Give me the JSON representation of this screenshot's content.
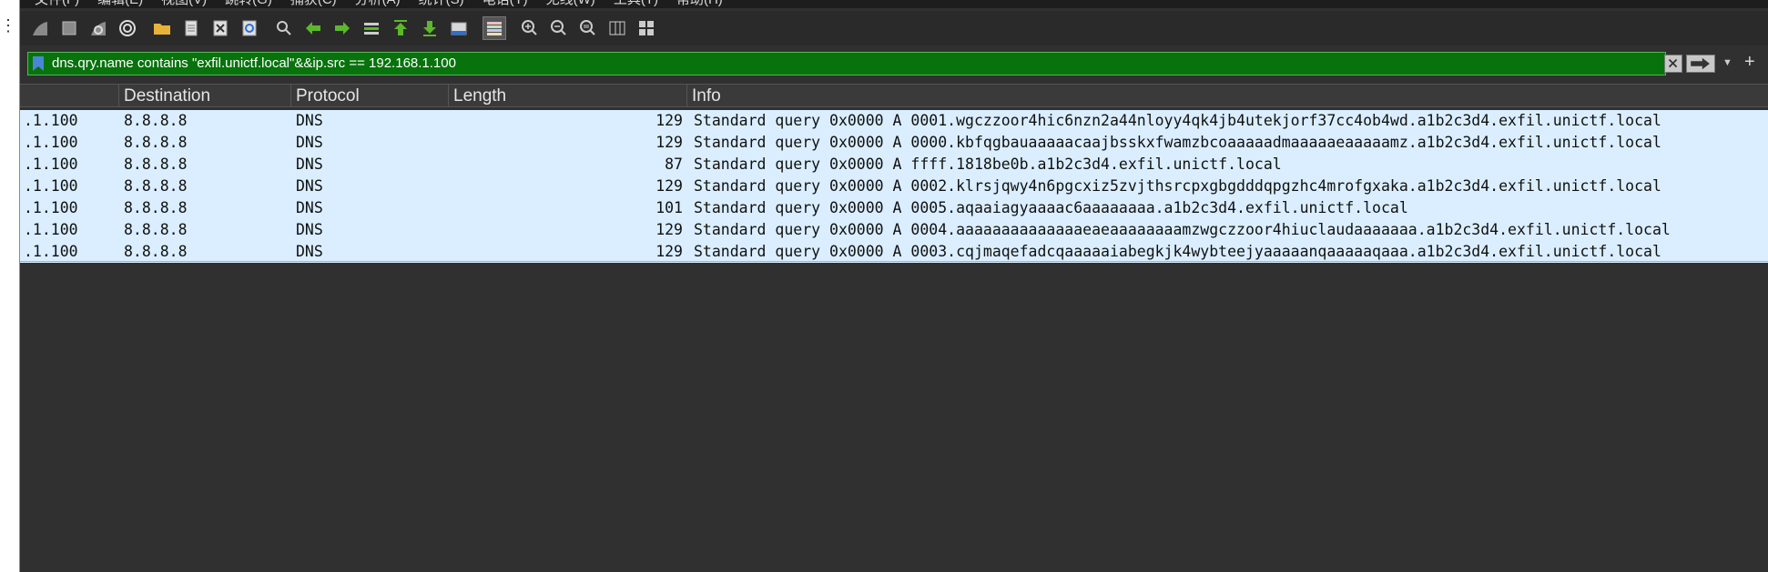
{
  "left_dots": "⋮",
  "menu": [
    "文件(F)",
    "编辑(E)",
    "视图(V)",
    "跳转(G)",
    "捕获(C)",
    "分析(A)",
    "统计(S)",
    "电话(Y)",
    "无线(W)",
    "工具(T)",
    "帮助(H)"
  ],
  "filter": {
    "text": "dns.qry.name contains \"exfil.unictf.local\"&&ip.src == 192.168.1.100"
  },
  "columns": [
    "Destination",
    "Protocol",
    "Length",
    "Info"
  ],
  "packets": [
    {
      "src": ".1.100",
      "dst": "8.8.8.8",
      "proto": "DNS",
      "len": "129",
      "info": "Standard query 0x0000 A 0001.wgczzoor4hic6nzn2a44nloyy4qk4jb4utekjorf37cc4ob4wd.a1b2c3d4.exfil.unictf.local"
    },
    {
      "src": ".1.100",
      "dst": "8.8.8.8",
      "proto": "DNS",
      "len": "129",
      "info": "Standard query 0x0000 A 0000.kbfqgbauaaaaacaajbsskxfwamzbcoaaaaadmaaaaaeaaaaamz.a1b2c3d4.exfil.unictf.local"
    },
    {
      "src": ".1.100",
      "dst": "8.8.8.8",
      "proto": "DNS",
      "len": "87",
      "info": "Standard query 0x0000 A ffff.1818be0b.a1b2c3d4.exfil.unictf.local"
    },
    {
      "src": ".1.100",
      "dst": "8.8.8.8",
      "proto": "DNS",
      "len": "129",
      "info": "Standard query 0x0000 A 0002.klrsjqwy4n6pgcxiz5zvjthsrcpxgbgdddqpgzhc4mrofgxaka.a1b2c3d4.exfil.unictf.local"
    },
    {
      "src": ".1.100",
      "dst": "8.8.8.8",
      "proto": "DNS",
      "len": "101",
      "info": "Standard query 0x0000 A 0005.aqaaiagyaaaac6aaaaaaaa.a1b2c3d4.exfil.unictf.local"
    },
    {
      "src": ".1.100",
      "dst": "8.8.8.8",
      "proto": "DNS",
      "len": "129",
      "info": "Standard query 0x0000 A 0004.aaaaaaaaaaaaaaeaeaaaaaaaamzwgczzoor4hiuclaudaaaaaaa.a1b2c3d4.exfil.unictf.local"
    },
    {
      "src": ".1.100",
      "dst": "8.8.8.8",
      "proto": "DNS",
      "len": "129",
      "info": "Standard query 0x0000 A 0003.cqjmaqefadcqaaaaaiabegkjk4wybteejyaaaaanqaaaaaqaaa.a1b2c3d4.exfil.unictf.local"
    }
  ],
  "colors": {
    "filter_bg": "#08720d",
    "row_bg": "#daeeff",
    "panel_bg": "#303030"
  }
}
